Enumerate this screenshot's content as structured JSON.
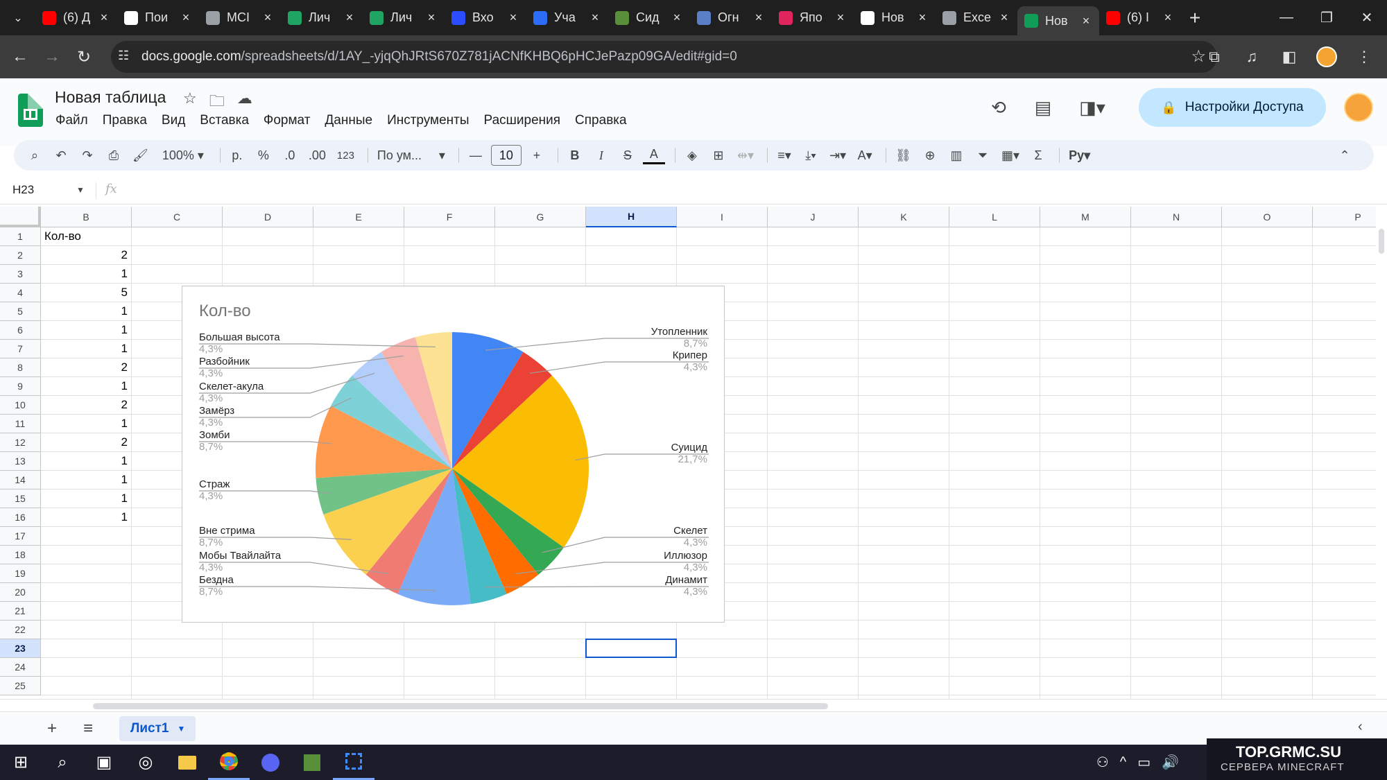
{
  "browser": {
    "tabs": [
      {
        "title": "(6) Д",
        "fav_color": "#ff0000",
        "icon": "youtube-icon"
      },
      {
        "title": "Пои",
        "fav_color": "#ffffff",
        "icon": "page-icon"
      },
      {
        "title": "МСІ",
        "fav_color": "#9aa0a6",
        "icon": "page-icon"
      },
      {
        "title": "Лич",
        "fav_color": "#1fa463",
        "icon": "drive-icon"
      },
      {
        "title": "Лич",
        "fav_color": "#1fa463",
        "icon": "drive-icon"
      },
      {
        "title": "Вхо",
        "fav_color": "#2b4cff",
        "icon": "k-icon"
      },
      {
        "title": "Уча",
        "fav_color": "#2d6cf6",
        "icon": "zoom-icon"
      },
      {
        "title": "Сид",
        "fav_color": "#5a8f3a",
        "icon": "block-icon"
      },
      {
        "title": "Огн",
        "fav_color": "#5b7fc7",
        "icon": "cube-icon"
      },
      {
        "title": "Япо",
        "fav_color": "#e0245e",
        "icon": "flame-icon"
      },
      {
        "title": "Нов",
        "fav_color": "#ffffff",
        "icon": "page-icon"
      },
      {
        "title": "Exce",
        "fav_color": "#9aa0a6",
        "icon": "page-icon"
      },
      {
        "title": "Нов",
        "fav_color": "#0f9d58",
        "icon": "sheets-icon"
      },
      {
        "title": "(6) I",
        "fav_color": "#ff0000",
        "icon": "youtube-icon"
      }
    ],
    "active_tab": 12,
    "url_host": "docs.google.com",
    "url_path": "/spreadsheets/d/1AY_-yjqQhJRtS670Z781jACNfKHBQ6pHCJePazp09GA/edit#gid=0"
  },
  "sheet": {
    "title": "Новая таблица",
    "menus": [
      "Файл",
      "Правка",
      "Вид",
      "Вставка",
      "Формат",
      "Данные",
      "Инструменты",
      "Расширения",
      "Справка"
    ],
    "share_label": "Настройки Доступа",
    "toolbar": {
      "zoom": "100%",
      "currency": "р.",
      "percent": "%",
      "dec_dec": ".0",
      "dec_inc": ".00",
      "num_format": "123",
      "font": "По ум...",
      "font_size": "10"
    },
    "name_box": "H23",
    "fx": "fx",
    "columns": [
      "B",
      "C",
      "D",
      "E",
      "F",
      "G",
      "H",
      "I",
      "J",
      "K",
      "L",
      "M",
      "N",
      "O",
      "P"
    ],
    "selected_column": "H",
    "rows": [
      "1",
      "2",
      "3",
      "4",
      "5",
      "6",
      "7",
      "8",
      "9",
      "10",
      "11",
      "12",
      "13",
      "14",
      "15",
      "16",
      "17",
      "18",
      "19",
      "20",
      "21",
      "22",
      "23",
      "24",
      "25"
    ],
    "selected_row": "23",
    "col_b_header": "Кол-во",
    "col_b_values": [
      "2",
      "1",
      "5",
      "1",
      "1",
      "1",
      "2",
      "1",
      "2",
      "1",
      "2",
      "1",
      "1",
      "1",
      "1"
    ],
    "sheet_tab": "Лист1"
  },
  "chart_data": {
    "type": "pie",
    "title": "Кол-во",
    "slices": [
      {
        "label": "Утопленник",
        "pct": "8,7%",
        "value": 2,
        "color": "#4285f4"
      },
      {
        "label": "Крипер",
        "pct": "4,3%",
        "value": 1,
        "color": "#ea4335"
      },
      {
        "label": "Суицид",
        "pct": "21,7%",
        "value": 5,
        "color": "#fbbc04"
      },
      {
        "label": "Скелет",
        "pct": "4,3%",
        "value": 1,
        "color": "#34a853"
      },
      {
        "label": "Иллюзор",
        "pct": "4,3%",
        "value": 1,
        "color": "#ff6d01"
      },
      {
        "label": "Динамит",
        "pct": "4,3%",
        "value": 1,
        "color": "#46bdc6"
      },
      {
        "label": "Бездна",
        "pct": "8,7%",
        "value": 2,
        "color": "#7baaf7"
      },
      {
        "label": "Мобы Твайлайта",
        "pct": "4,3%",
        "value": 1,
        "color": "#f07b72"
      },
      {
        "label": "Вне стрима",
        "pct": "8,7%",
        "value": 2,
        "color": "#fcd04f"
      },
      {
        "label": "Страж",
        "pct": "4,3%",
        "value": 1,
        "color": "#71c287"
      },
      {
        "label": "Зомби",
        "pct": "8,7%",
        "value": 2,
        "color": "#ff994d"
      },
      {
        "label": "Замёрз",
        "pct": "4,3%",
        "value": 1,
        "color": "#7ed1d7"
      },
      {
        "label": "Скелет-акула",
        "pct": "4,3%",
        "value": 1,
        "color": "#b3cefb"
      },
      {
        "label": "Разбойник",
        "pct": "4,3%",
        "value": 1,
        "color": "#f7b4ae"
      },
      {
        "label": "Большая высота",
        "pct": "4,3%",
        "value": 1,
        "color": "#fde293"
      }
    ]
  },
  "watermark": {
    "line1": "TOP.GRMC.SU",
    "line2": "СЕРВЕРА MINECRAFT"
  }
}
